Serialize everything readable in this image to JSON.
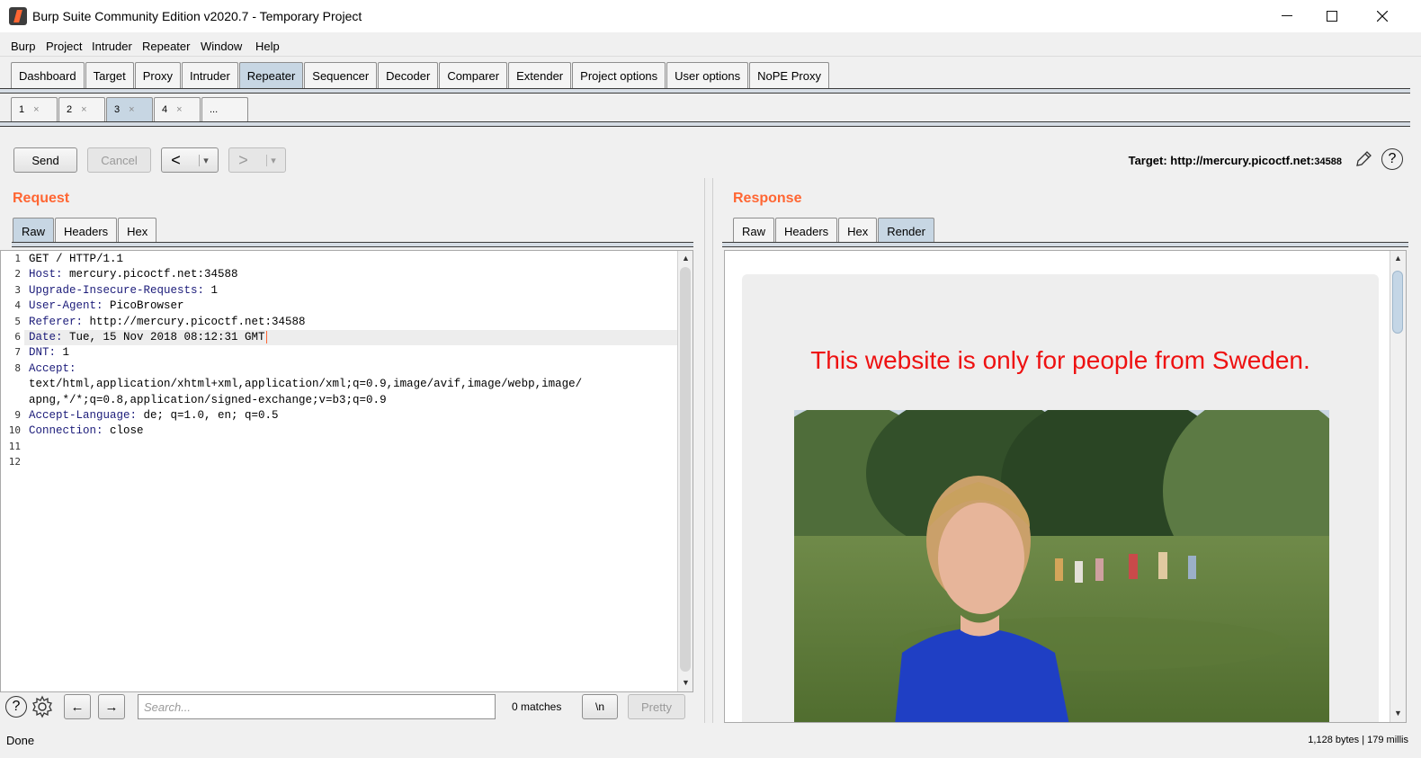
{
  "window": {
    "title": "Burp Suite Community Edition v2020.7 - Temporary Project"
  },
  "menu": [
    "Burp",
    "Project",
    "Intruder",
    "Repeater",
    "Window",
    "Help"
  ],
  "main_tabs": [
    "Dashboard",
    "Target",
    "Proxy",
    "Intruder",
    "Repeater",
    "Sequencer",
    "Decoder",
    "Comparer",
    "Extender",
    "Project options",
    "User options",
    "NoPE Proxy"
  ],
  "main_tab_active": "Repeater",
  "repeater_tabs": [
    {
      "label": "1",
      "close": "×"
    },
    {
      "label": "2",
      "close": "×"
    },
    {
      "label": "3",
      "close": "×"
    },
    {
      "label": "4",
      "close": "×"
    },
    {
      "label": "...",
      "close": ""
    }
  ],
  "repeater_tab_active": "3",
  "toolbar": {
    "send": "Send",
    "cancel": "Cancel",
    "back": "<",
    "forward": ">",
    "dropdown": "▾",
    "target_prefix": "Target: http://mercury.picoctf.net:",
    "target_port": "34588",
    "help": "?"
  },
  "request": {
    "title": "Request",
    "tabs": [
      "Raw",
      "Headers",
      "Hex"
    ],
    "active_tab": "Raw",
    "lines": [
      {
        "n": "1",
        "key": "",
        "val": "GET / HTTP/1.1"
      },
      {
        "n": "2",
        "key": "Host:",
        "val": " mercury.picoctf.net:34588"
      },
      {
        "n": "3",
        "key": "Upgrade-Insecure-Requests:",
        "val": " 1"
      },
      {
        "n": "4",
        "key": "User-Agent:",
        "val": " PicoBrowser"
      },
      {
        "n": "5",
        "key": "Referer:",
        "val": " http://mercury.picoctf.net:34588"
      },
      {
        "n": "6",
        "key": "Date:",
        "val": " Tue, 15 Nov 2018 08:12:31 GMT"
      },
      {
        "n": "7",
        "key": "DNT:",
        "val": " 1"
      },
      {
        "n": "8",
        "key": "Accept:",
        "val": ""
      },
      {
        "n": "",
        "key": "",
        "val": "text/html,application/xhtml+xml,application/xml;q=0.9,image/avif,image/webp,image/"
      },
      {
        "n": "",
        "key": "",
        "val": "apng,*/*;q=0.8,application/signed-exchange;v=b3;q=0.9"
      },
      {
        "n": "9",
        "key": "Accept-Language:",
        "val": " de; q=1.0, en; q=0.5"
      },
      {
        "n": "10",
        "key": "Connection:",
        "val": " close"
      },
      {
        "n": "11",
        "key": "",
        "val": ""
      },
      {
        "n": "12",
        "key": "",
        "val": ""
      }
    ],
    "search_placeholder": "Search...",
    "matches": "0 matches",
    "newline_btn": "\\n",
    "pretty_btn": "Pretty",
    "prev": "←",
    "next": "→",
    "help": "?"
  },
  "response": {
    "title": "Response",
    "tabs": [
      "Raw",
      "Headers",
      "Hex",
      "Render"
    ],
    "active_tab": "Render",
    "render_heading": "This website is only for people from Sweden."
  },
  "status": {
    "left": "Done",
    "right": "1,128 bytes | 179 millis"
  },
  "colors": {
    "accent": "#ff6633",
    "active_tab": "#c7d6e3",
    "render_heading": "#ee1111"
  }
}
